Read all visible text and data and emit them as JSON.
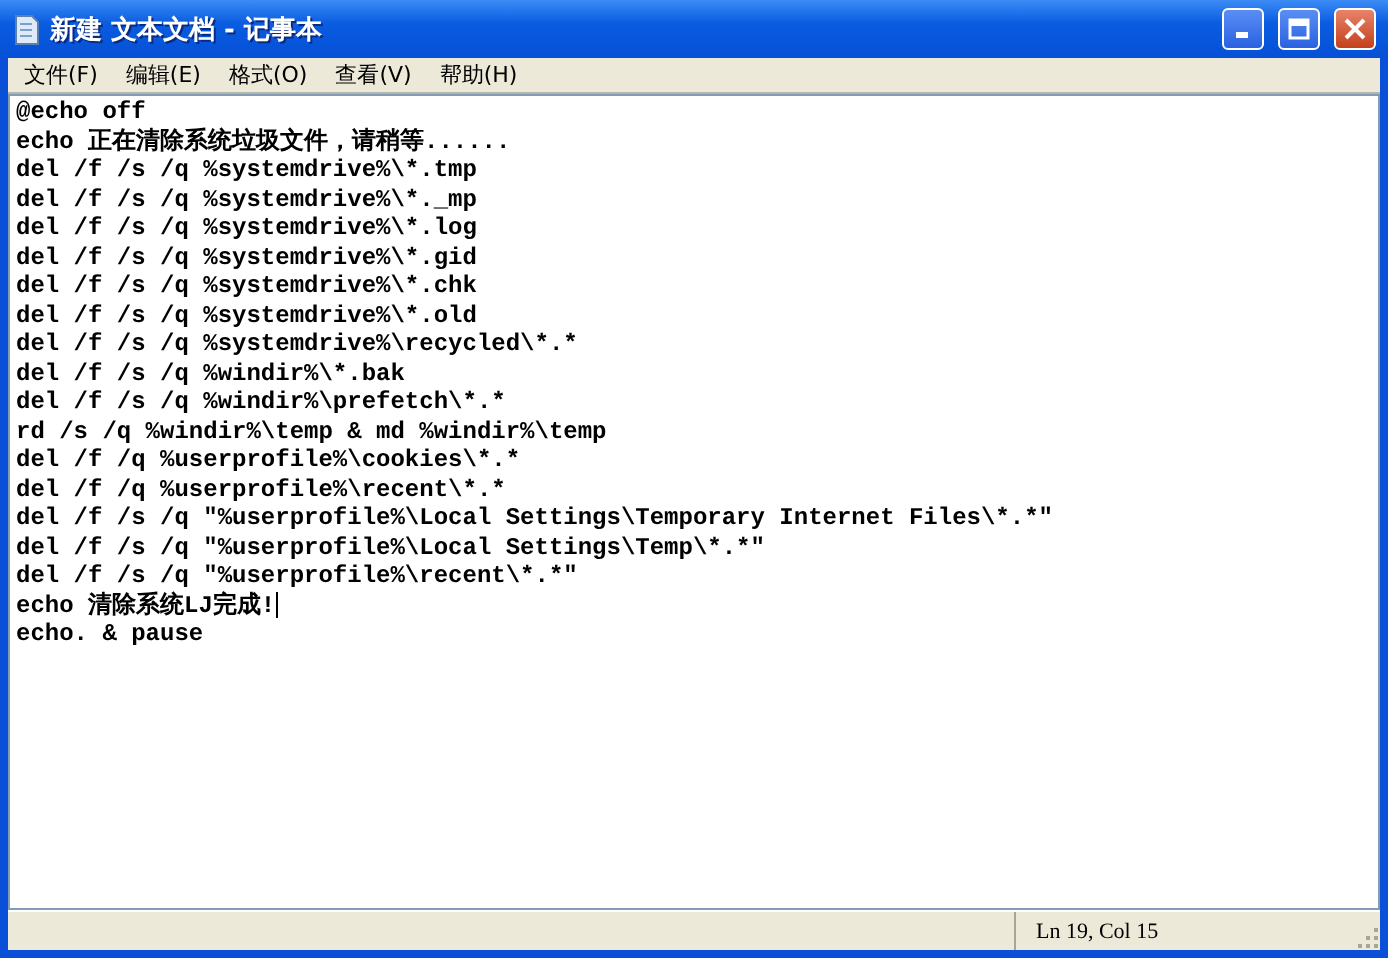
{
  "window": {
    "title": "新建 文本文档 - 记事本"
  },
  "menu": [
    "文件(F)",
    "编辑(E)",
    "格式(O)",
    "查看(V)",
    "帮助(H)"
  ],
  "editor": {
    "lines": [
      {
        "text": "@echo off",
        "cursor": false
      },
      {
        "text": "echo 正在清除系统垃圾文件，请稍等......",
        "cursor": false
      },
      {
        "text": "del /f /s /q %systemdrive%\\*.tmp",
        "cursor": false
      },
      {
        "text": "del /f /s /q %systemdrive%\\*._mp",
        "cursor": false
      },
      {
        "text": "del /f /s /q %systemdrive%\\*.log",
        "cursor": false
      },
      {
        "text": "del /f /s /q %systemdrive%\\*.gid",
        "cursor": false
      },
      {
        "text": "del /f /s /q %systemdrive%\\*.chk",
        "cursor": false
      },
      {
        "text": "del /f /s /q %systemdrive%\\*.old",
        "cursor": false
      },
      {
        "text": "del /f /s /q %systemdrive%\\recycled\\*.*",
        "cursor": false
      },
      {
        "text": "del /f /s /q %windir%\\*.bak",
        "cursor": false
      },
      {
        "text": "del /f /s /q %windir%\\prefetch\\*.*",
        "cursor": false
      },
      {
        "text": "rd /s /q %windir%\\temp & md %windir%\\temp",
        "cursor": false
      },
      {
        "text": "del /f /q %userprofile%\\cookies\\*.*",
        "cursor": false
      },
      {
        "text": "del /f /q %userprofile%\\recent\\*.*",
        "cursor": false
      },
      {
        "text": "del /f /s /q \"%userprofile%\\Local Settings\\Temporary Internet Files\\*.*\"",
        "cursor": false
      },
      {
        "text": "del /f /s /q \"%userprofile%\\Local Settings\\Temp\\*.*\"",
        "cursor": false
      },
      {
        "text": "del /f /s /q \"%userprofile%\\recent\\*.*\"",
        "cursor": false
      },
      {
        "text": "echo 清除系统LJ完成!",
        "cursor": true
      },
      {
        "text": "echo. & pause",
        "cursor": false
      }
    ]
  },
  "status_bar": {
    "position": "Ln 19, Col 15"
  }
}
